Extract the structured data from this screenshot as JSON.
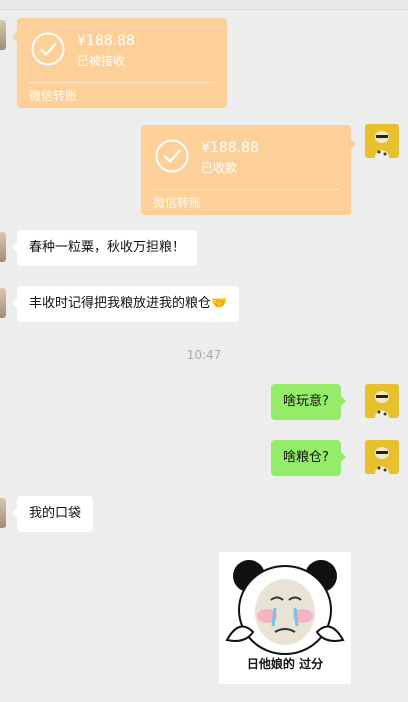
{
  "messages": {
    "transfer_received": {
      "amount": "¥188.88",
      "status": "已被接收",
      "footer": "微信转账"
    },
    "transfer_sent": {
      "amount": "¥188.88",
      "status": "已收款",
      "footer": "微信转账"
    },
    "msg1": "春种一粒粟，秋收万担粮！",
    "msg2": "丰收时记得把我粮放进我的粮仓",
    "msg2_emoji": "🤝",
    "timestamp": "10:47",
    "msg3": "啥玩意?",
    "msg4": "啥粮仓?",
    "msg5": "我的口袋",
    "sticker_caption": "日他娘的 过分"
  },
  "colors": {
    "background": "#ededed",
    "transfer_card": "#fdcf99",
    "sent_bubble": "#95ec69",
    "received_bubble": "#ffffff"
  }
}
